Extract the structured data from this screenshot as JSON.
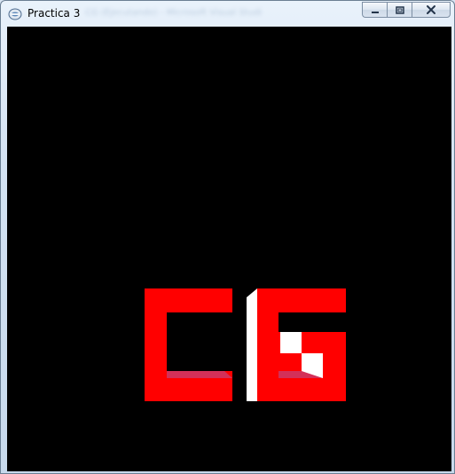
{
  "window": {
    "title": "Practica 3",
    "background_title_text": "CG (Ejecutando) - Microsoft Visual Studio"
  },
  "icons": {
    "app": "application-icon",
    "minimize": "minimize-icon",
    "maximize": "maximize-icon",
    "close": "close-icon"
  },
  "scene": {
    "background_color": "#000000",
    "letters": [
      "C",
      "G"
    ],
    "colors": {
      "letter_front": "#ff0000",
      "letter_bottom_face": "#d33058",
      "side_face": "#ffffff"
    }
  }
}
